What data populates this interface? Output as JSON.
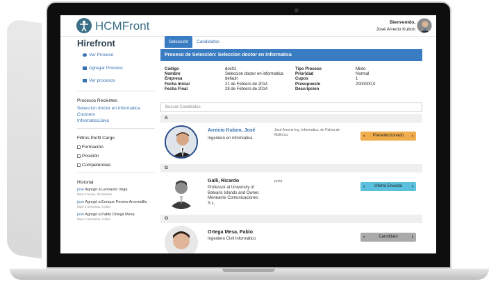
{
  "header": {
    "logo_text": "HCMFront",
    "welcome_label": "Bienvenido,",
    "user_name": "José Arrecio Kubon"
  },
  "sidebar": {
    "title": "Hirefront",
    "links": [
      "Ver Proceso",
      "Agregar Proceso",
      "Ver procesos"
    ],
    "recent_heading": "Procesos Recientes",
    "recent_items": [
      "Seleccion doctor en informatica",
      "Cocinero",
      "InformaticoJava"
    ],
    "filters_heading": "Filtros Perfil Cargo",
    "filters": [
      "Formación",
      "Posición",
      "Competencias"
    ],
    "history_heading": "Historial",
    "history": [
      {
        "user": "jose",
        "text": "Agregó a Leonardo Vega",
        "time": "hace 6 horas, 32 minutos"
      },
      {
        "user": "jose",
        "text": "Agregó a Enrique Pereiro Arceredillo",
        "time": "hace 2 semanas, 6 días"
      },
      {
        "user": "jose",
        "text": "Agregó a Pablo Ortega Mesa",
        "time": "hace 2 semanas, 6 días"
      }
    ]
  },
  "tabs": [
    "Selección",
    "Candidatos"
  ],
  "process": {
    "header": "Proceso de Selección: Seleccion doctor en informatica",
    "left_labels": [
      "Código",
      "Nombre",
      "Empresa",
      "Fecha Inicial",
      "Fecha Final"
    ],
    "left_values": [
      "doc01",
      "Seleccion doctor en informatica",
      "default",
      "21 de Febrero de 2014",
      "28 de Febrero de 2014"
    ],
    "right_labels": [
      "Tipo Proceso",
      "Prioridad",
      "Cupos",
      "Presupuesto",
      "Descripcion"
    ],
    "right_values": [
      "Mixto",
      "Normal",
      "1",
      "2000000,0",
      ""
    ]
  },
  "search": {
    "placeholder": "Buscar Candidatos"
  },
  "groups": [
    {
      "letter": "A",
      "candidate": {
        "name": "Arrecio Kubon, José",
        "subtitle": "Ingeniero en informática",
        "description": "José Arrecio Ing. Informatico, de Palma de Mallorca.",
        "status": "Preseleccionado",
        "status_color": "#f0ad4e"
      }
    },
    {
      "letter": "G",
      "candidate": {
        "name": "Galli, Ricardo",
        "subtitle": "Professor at University of Balearic Islands and Owner, Menéame Comunicaciones S.L.",
        "description": "prota",
        "status": "Oferta Enviada",
        "status_color": "#5bc0de"
      }
    },
    {
      "letter": "O",
      "candidate": {
        "name": "Ortega Mesa, Pablo",
        "subtitle": "Ingeniero Civil Informático",
        "description": "",
        "status": "Candidato",
        "status_color": "#aaaaaa"
      }
    }
  ],
  "colors": {
    "primary": "#3a7cc2",
    "logo": "#3b6f86",
    "link": "#3570b0"
  }
}
